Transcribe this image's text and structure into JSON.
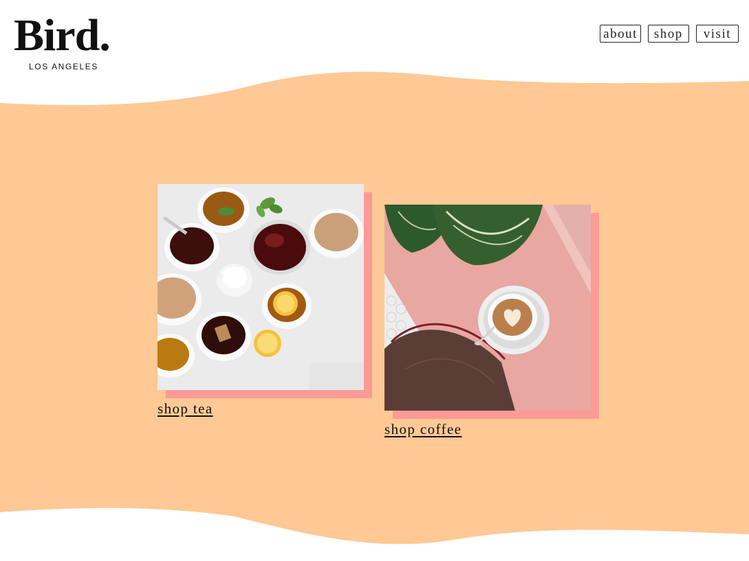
{
  "brand": {
    "name": "Bird.",
    "tagline": "LOS ANGELES"
  },
  "nav": {
    "items": [
      {
        "label": "about"
      },
      {
        "label": "shop"
      },
      {
        "label": "visit"
      }
    ]
  },
  "products": [
    {
      "label": "shop tea",
      "photo": "tea-cups-photo"
    },
    {
      "label": "shop coffee",
      "photo": "latte-on-pink-table-photo"
    }
  ],
  "colors": {
    "band": "#fec995",
    "accent_shadow": "#fb9a96",
    "text": "#111111",
    "background": "#ffffff"
  }
}
